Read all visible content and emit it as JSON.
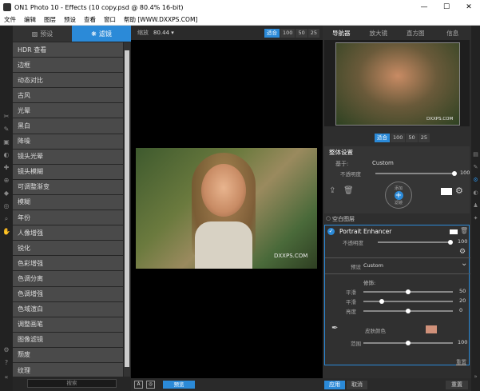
{
  "window": {
    "title": "ON1 Photo 10 - Effects (10 copy.psd @ 80.4% 16-bit)",
    "minimize": "—",
    "maximize": "☐",
    "close": "✕"
  },
  "menu": [
    "文件",
    "编辑",
    "图层",
    "预设",
    "查看",
    "窗口",
    "帮助 [WWW.DXXPS.COM]"
  ],
  "left_panel": {
    "tabs": [
      {
        "label": "预设",
        "icon": "image-icon",
        "active": false
      },
      {
        "label": "滤镜",
        "icon": "filter-icon",
        "active": true
      }
    ],
    "filters": [
      "HDR 查看",
      "边框",
      "动态对比",
      "古风",
      "光晕",
      "黑白",
      "降噪",
      "镜头光晕",
      "镜头模糊",
      "可调整渐变",
      "模糊",
      "年份",
      "人像增强",
      "锐化",
      "色彩增强",
      "色调分离",
      "色调增强",
      "色域渲白",
      "调整画笔",
      "图像滤镜",
      "颓废",
      "纹理"
    ],
    "search_placeholder": "搜索"
  },
  "center": {
    "zoom_label": "缩放",
    "zoom_value": "80.44 ▾",
    "zoom_buttons": [
      "适合",
      "100",
      "50",
      "25"
    ],
    "watermark": "DXXPS.COM",
    "bottom": {
      "a_label": "A",
      "compare_label": "◎",
      "preview_label": "预览"
    }
  },
  "right_panel": {
    "tabs": [
      "导航器",
      "放大镜",
      "直方图",
      "信息"
    ],
    "nav_watermark": "DXXPS.COM",
    "nav_zoom": [
      "适合",
      "100",
      "50",
      "25"
    ],
    "global": {
      "title": "整体设置",
      "base_label": "基于:",
      "base_value": "Custom",
      "opacity_label": "不透明度",
      "opacity_value": "100",
      "add_title": "添加",
      "add_sub": "滤镜",
      "add_symbol": "+"
    },
    "layer_label": "空白图层",
    "filter": {
      "name": "Portrait Enhancer",
      "opacity_label": "不透明度",
      "opacity_value": "100",
      "preset_label": "预设",
      "preset_value": "Custom",
      "section": "修饰:",
      "sliders": [
        {
          "label": "平滑",
          "value": "50"
        },
        {
          "label": "平滑",
          "value": "20"
        },
        {
          "label": "亮度",
          "value": "0"
        }
      ],
      "skin_label": "皮肤颜色",
      "skin_color": "#d0917a",
      "range_label": "范围",
      "range_value": "100",
      "reset": "重置"
    },
    "bottom": {
      "apply": "应用",
      "cancel": "取消",
      "reset": "重置"
    }
  },
  "accent_color": "#2b8ad8"
}
